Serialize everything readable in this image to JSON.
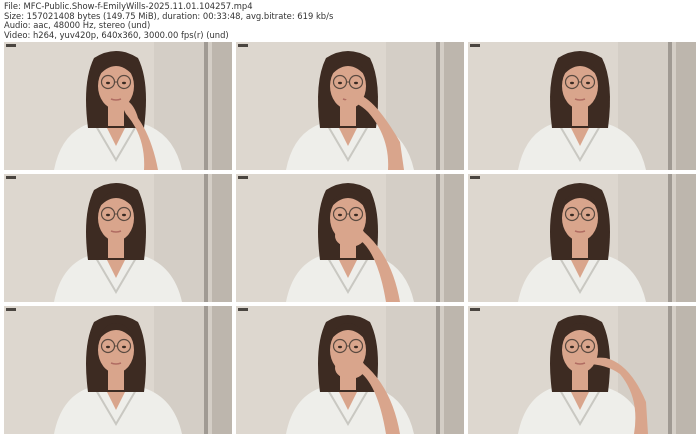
{
  "header": {
    "line1": "File: MFC-Public.Show-f-EmilyWills-2025.11.01.104257.mp4",
    "line2": "Size: 157021408 bytes (149.75 MiB), duration: 00:33:48, avg.bitrate: 619 kb/s",
    "line3": "Audio: aac, 48000 Hz, stereo (und)",
    "line4": "Video: h264, yuv420p, 640x360, 3000.00 fps(r) (und)"
  },
  "thumbnails": [
    {
      "pose": "hand-chin-left",
      "timestamp": ""
    },
    {
      "pose": "hand-mouth",
      "timestamp": ""
    },
    {
      "pose": "neutral",
      "timestamp": ""
    },
    {
      "pose": "neutral",
      "timestamp": ""
    },
    {
      "pose": "hand-mouth-both",
      "timestamp": ""
    },
    {
      "pose": "neutral",
      "timestamp": ""
    },
    {
      "pose": "neutral",
      "timestamp": ""
    },
    {
      "pose": "hand-mouth-both",
      "timestamp": ""
    },
    {
      "pose": "hand-mouth-right",
      "timestamp": ""
    }
  ],
  "colors": {
    "wall": "#d4cec6",
    "wall_light": "#e3ded7",
    "door_frame": "#6b6660",
    "hair": "#3d2b22",
    "skin": "#d9a58c",
    "shirt": "#eeeeea",
    "shirt_shadow": "#c9c8c2",
    "glasses": "#5a4a40",
    "lips": "#b06c62"
  },
  "icons": {
    "frame_icon": "video-frame-icon"
  }
}
